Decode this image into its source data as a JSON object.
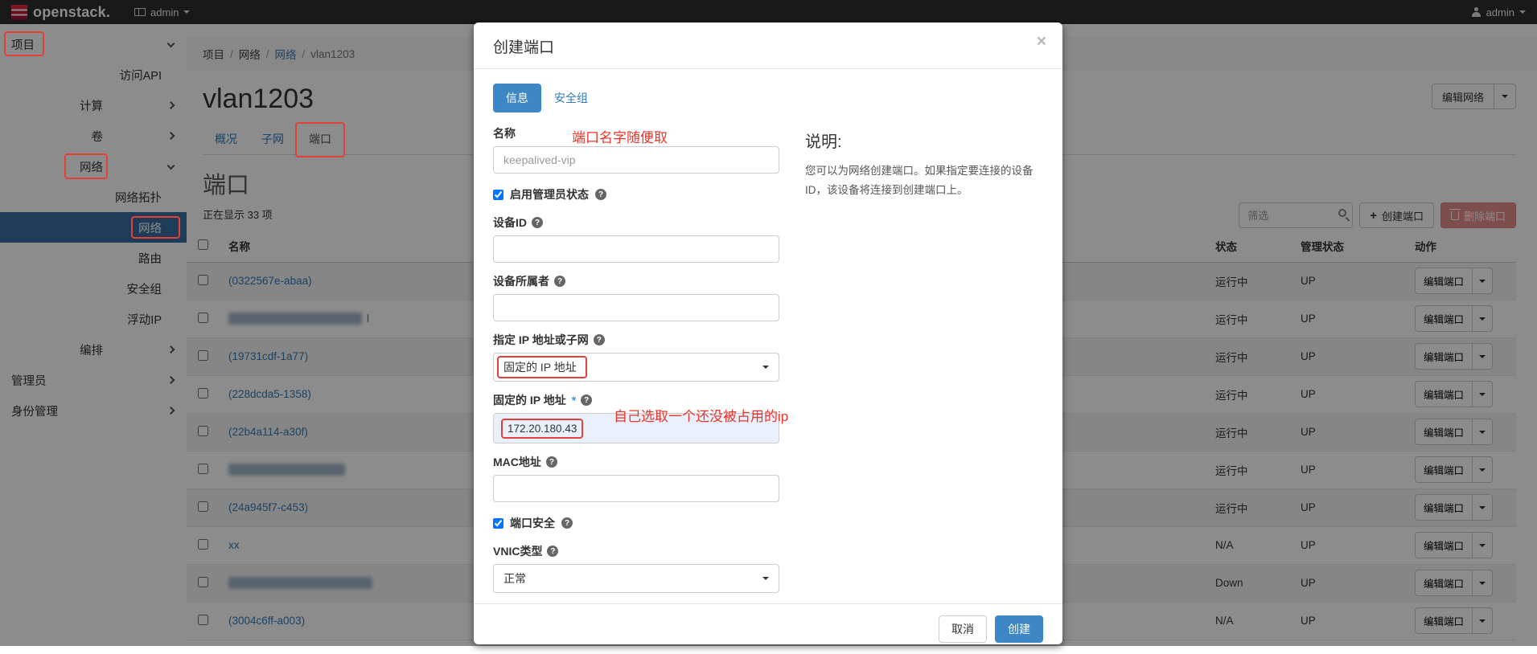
{
  "navbar": {
    "brand": "openstack.",
    "context_label": "admin",
    "user_label": "admin"
  },
  "sidebar": {
    "items": [
      {
        "label": "项目"
      },
      {
        "label": "访问API"
      },
      {
        "label": "计算"
      },
      {
        "label": "卷"
      },
      {
        "label": "网络"
      },
      {
        "label": "网络拓扑"
      },
      {
        "label": "网络"
      },
      {
        "label": "路由"
      },
      {
        "label": "安全组"
      },
      {
        "label": "浮动IP"
      },
      {
        "label": "编排"
      },
      {
        "label": "管理员"
      },
      {
        "label": "身份管理"
      }
    ]
  },
  "breadcrumb": {
    "separator": "/",
    "items": [
      "项目",
      "网络",
      "网络",
      "vlan1203"
    ]
  },
  "page": {
    "title": "vlan1203",
    "edit_network_label": "编辑网络"
  },
  "tabs": {
    "overview": "概况",
    "subnets": "子网",
    "ports": "端口"
  },
  "ports_section": {
    "heading": "端口",
    "count_text": "正在显示 33 项",
    "filter_placeholder": "筛选",
    "create_label": "创建端口",
    "delete_label": "删除端口"
  },
  "table": {
    "headers": {
      "name": "名称",
      "status": "状态",
      "admin_state": "管理状态",
      "actions": "动作"
    },
    "edit_label": "编辑端口",
    "rows": [
      {
        "name": "(0322567e-abaa)",
        "status": "运行中",
        "admin_state": "UP"
      },
      {
        "name": "",
        "suffix": "l",
        "status": "运行中",
        "admin_state": "UP"
      },
      {
        "name": "(19731cdf-1a77)",
        "status": "运行中",
        "admin_state": "UP"
      },
      {
        "name": "(228dcda5-1358)",
        "status": "运行中",
        "admin_state": "UP"
      },
      {
        "name": "(22b4a114-a30f)",
        "status": "运行中",
        "admin_state": "UP"
      },
      {
        "name": "",
        "suffix": "",
        "status": "运行中",
        "admin_state": "UP"
      },
      {
        "name": "(24a945f7-c453)",
        "status": "运行中",
        "admin_state": "UP"
      },
      {
        "name": "xx",
        "status": "N/A",
        "admin_state": "UP"
      },
      {
        "name": "",
        "suffix": "",
        "status": "Down",
        "admin_state": "UP"
      },
      {
        "name": "(3004c6ff-a003)",
        "status": "N/A",
        "admin_state": "UP"
      }
    ]
  },
  "modal": {
    "title": "创建端口",
    "close_glyph": "×",
    "help_glyph": "?",
    "required_mark": "*",
    "tabs": {
      "info": "信息",
      "security_groups": "安全组"
    },
    "fields": {
      "name_label": "名称",
      "name_placeholder": "keepalived-vip",
      "admin_state_label": "启用管理员状态",
      "device_id_label": "设备ID",
      "device_owner_label": "设备所属者",
      "ip_or_subnet_label": "指定 IP 地址或子网",
      "ip_or_subnet_value": "固定的 IP 地址",
      "fixed_ip_label": "固定的 IP 地址",
      "fixed_ip_value": "172.20.180.43",
      "mac_label": "MAC地址",
      "port_security_label": "端口安全",
      "vnic_label": "VNIC类型",
      "vnic_value": "正常"
    },
    "annotations": {
      "name_hint": "端口名字随便取",
      "ip_hint": "自己选取一个还没被占用的ip"
    },
    "description": {
      "heading": "说明:",
      "body": "您可以为网络创建端口。如果指定要连接的设备ID，该设备将连接到创建端口上。"
    },
    "footer": {
      "cancel": "取消",
      "submit": "创建"
    }
  },
  "colors": {
    "primary_blue": "#3d87c6",
    "link_blue": "#337ab7",
    "sidebar_active": "#376ea1",
    "danger_red": "#d9534f",
    "annotation_red": "#e2413a",
    "navbar_bg": "#2e2e2e"
  }
}
